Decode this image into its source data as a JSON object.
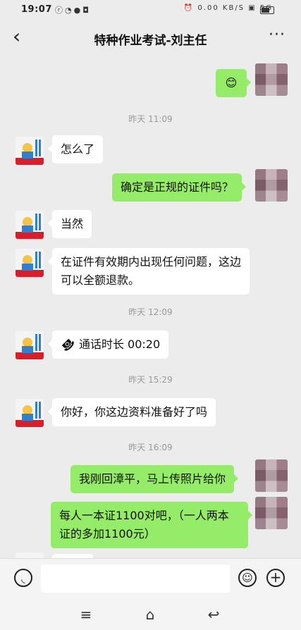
{
  "status_bar": {
    "time": "19:07",
    "left_icons": [
      "notification-icon",
      "message-icon",
      "vpn-icon",
      "shield-icon"
    ],
    "right_icons": [
      "alarm-icon",
      "network-speed",
      "hd-icon",
      "signal-5g-icon",
      "battery-icon"
    ],
    "network_speed": "0.00 KB/S",
    "network_type": "5G"
  },
  "header": {
    "back_icon": "chevron-left-icon",
    "title": "特种作业考试-刘主任",
    "more_icon": "more-horizontal-icon"
  },
  "messages": [
    {
      "type": "message",
      "side": "right",
      "text": "😊",
      "kind": "emoji"
    },
    {
      "type": "timestamp",
      "text": "昨天 11:09"
    },
    {
      "type": "message",
      "side": "left",
      "text": "怎么了"
    },
    {
      "type": "message",
      "side": "right",
      "text": "确定是正规的证件吗？"
    },
    {
      "type": "message",
      "side": "left",
      "text": "当然"
    },
    {
      "type": "message",
      "side": "left",
      "text": "在证件有效期内出现任何问题，这边可以全额退款。"
    },
    {
      "type": "timestamp",
      "text": "昨天 12:09"
    },
    {
      "type": "message",
      "side": "left",
      "text": "通话时长 00:20",
      "icon": "phone-hangup-icon"
    },
    {
      "type": "timestamp",
      "text": "昨天 15:29"
    },
    {
      "type": "message",
      "side": "left",
      "text": "你好，你这边资料准备好了吗"
    },
    {
      "type": "timestamp",
      "text": "昨天 16:09"
    },
    {
      "type": "message",
      "side": "right",
      "text": "我刚回漳平，马上传照片给你"
    },
    {
      "type": "message",
      "side": "right",
      "text": "每人一本证1100对吧，（一人两本证的多加1100元）"
    }
  ],
  "input_bar": {
    "voice_icon": "voice-input-icon",
    "emoji_icon": "emoji-icon",
    "plus_icon": "plus-circle-icon"
  },
  "system_nav": [
    "menu-icon",
    "home-icon",
    "back-icon"
  ],
  "colors": {
    "background": "#ededed",
    "bubble_self": "#95ec69",
    "bubble_other": "#ffffff",
    "timestamp": "#999999"
  }
}
